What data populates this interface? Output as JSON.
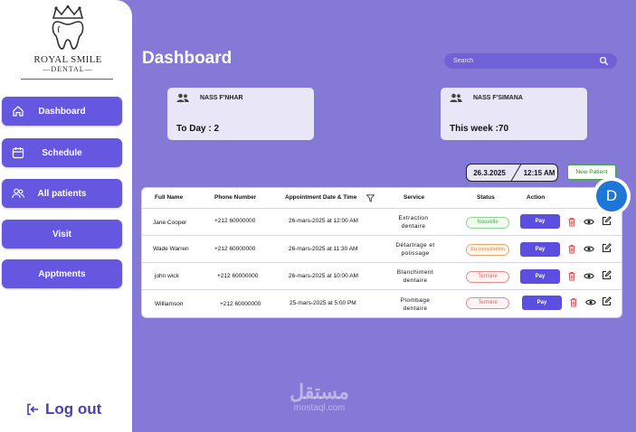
{
  "brand": {
    "name": "ROYAL SMILE",
    "sub": "DENTAL"
  },
  "sidebar": {
    "items": [
      {
        "label": "Dashboard",
        "icon": "home-icon"
      },
      {
        "label": "Schedule",
        "icon": "calendar-icon"
      },
      {
        "label": "All patients",
        "icon": "users-icon"
      },
      {
        "label": "Visit"
      },
      {
        "label": "Apptments"
      }
    ],
    "logout_label": "Log out"
  },
  "header": {
    "title": "Dashboard",
    "search_placeholder": "Search"
  },
  "cards": [
    {
      "label": "NASS F'NHAR",
      "value": "To Day : 2"
    },
    {
      "label": "NASS F'SIMANA",
      "value": "This week :70"
    }
  ],
  "datetime": {
    "date": "26.3.2025",
    "time": "12:15 AM"
  },
  "new_patient_label": "New Patient",
  "avatar_letter": "D",
  "table": {
    "headers": [
      "Full Name",
      "Phone Number",
      "Appointment Date & Time",
      "Service",
      "Status",
      "Action"
    ],
    "pay_label": "Pay",
    "rows": [
      {
        "name": "Jane  Cooper",
        "phone": "+212 60000000",
        "date": "26-mars-2025 at 12:00 AM",
        "service": [
          "Extraction",
          "dentaire"
        ],
        "status": "Nouvelle",
        "status_kind": "green"
      },
      {
        "name": "Wade  Warren",
        "phone": "+212 60000000",
        "date": "26-mars-2025 at 11:30 AM",
        "service": [
          "Détartrage et",
          "polissage"
        ],
        "status": "En consultation",
        "status_kind": "orange"
      },
      {
        "name": "john wick",
        "phone": "+212 60000000",
        "date": "26-mars-2025 at 10:00 AM",
        "service": [
          "Blanchiment",
          "dentaire"
        ],
        "status": "Terminé",
        "status_kind": "red"
      },
      {
        "name": "Williamson",
        "phone": "+212 60000000",
        "date": "25-mars-2025 at 5:00 PM",
        "service": [
          "Plombage",
          "dentaire"
        ],
        "status": "Terminé",
        "status_kind": "red"
      }
    ]
  },
  "watermark": {
    "arabic": "مستقل",
    "latin": "mostaql.com"
  },
  "colors": {
    "background": "#8479d6",
    "accent": "#6557e0",
    "card": "#e9e7f7"
  }
}
